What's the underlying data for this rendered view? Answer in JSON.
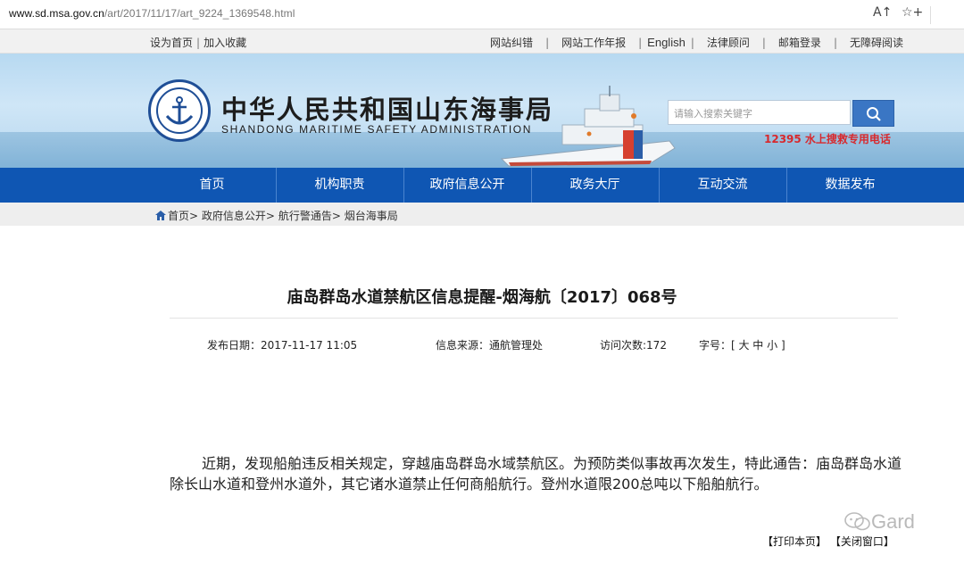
{
  "browser": {
    "url_host": "www.sd.msa.gov.cn",
    "url_path": "/art/2017/11/17/art_9224_1369548.html",
    "read_aloud_icon": "A↑",
    "favorite_icon": "☆+"
  },
  "topbar": {
    "set_home": "设为首页",
    "add_favorite": "加入收藏",
    "links": [
      "网站纠错",
      "网站工作年报",
      "English",
      "法律顾问",
      "邮箱登录",
      "无障碍阅读"
    ]
  },
  "header": {
    "title_cn": "中华人民共和国山东海事局",
    "title_en": "SHANDONG MARITIME SAFETY ADMINISTRATION",
    "search_placeholder": "请输入搜索关键字",
    "hotline": "12395 水上搜救专用电话",
    "colors": {
      "nav": "#0f56b3",
      "hotline": "#d8282c",
      "search_btn": "#3a76c4"
    }
  },
  "nav": {
    "items": [
      "首页",
      "机构职责",
      "政府信息公开",
      "政务大厅",
      "互动交流",
      "数据发布"
    ]
  },
  "breadcrumb": {
    "items": [
      "首页",
      "政府信息公开",
      "航行警通告",
      "烟台海事局"
    ],
    "separator": ">"
  },
  "article": {
    "title": "庙岛群岛水道禁航区信息提醒-烟海航〔2017〕068号",
    "publish_date": "发布日期：2017-11-17  11:05",
    "source": "信息来源：通航管理处",
    "visits": "访问次数:172",
    "font_size_label": "字号：[ 大 中 小 ]",
    "body": "近期，发现船舶违反相关规定，穿越庙岛群岛水域禁航区。为预防类似事故再次发生，特此通告：庙岛群岛水道除长山水道和登州水道外，其它诸水道禁止任何商船航行。登州水道限200总吨以下船舶航行。"
  },
  "footer": {
    "print": "【打印本页】",
    "close": "【关闭窗口】"
  },
  "watermark": {
    "text": "Gard"
  }
}
